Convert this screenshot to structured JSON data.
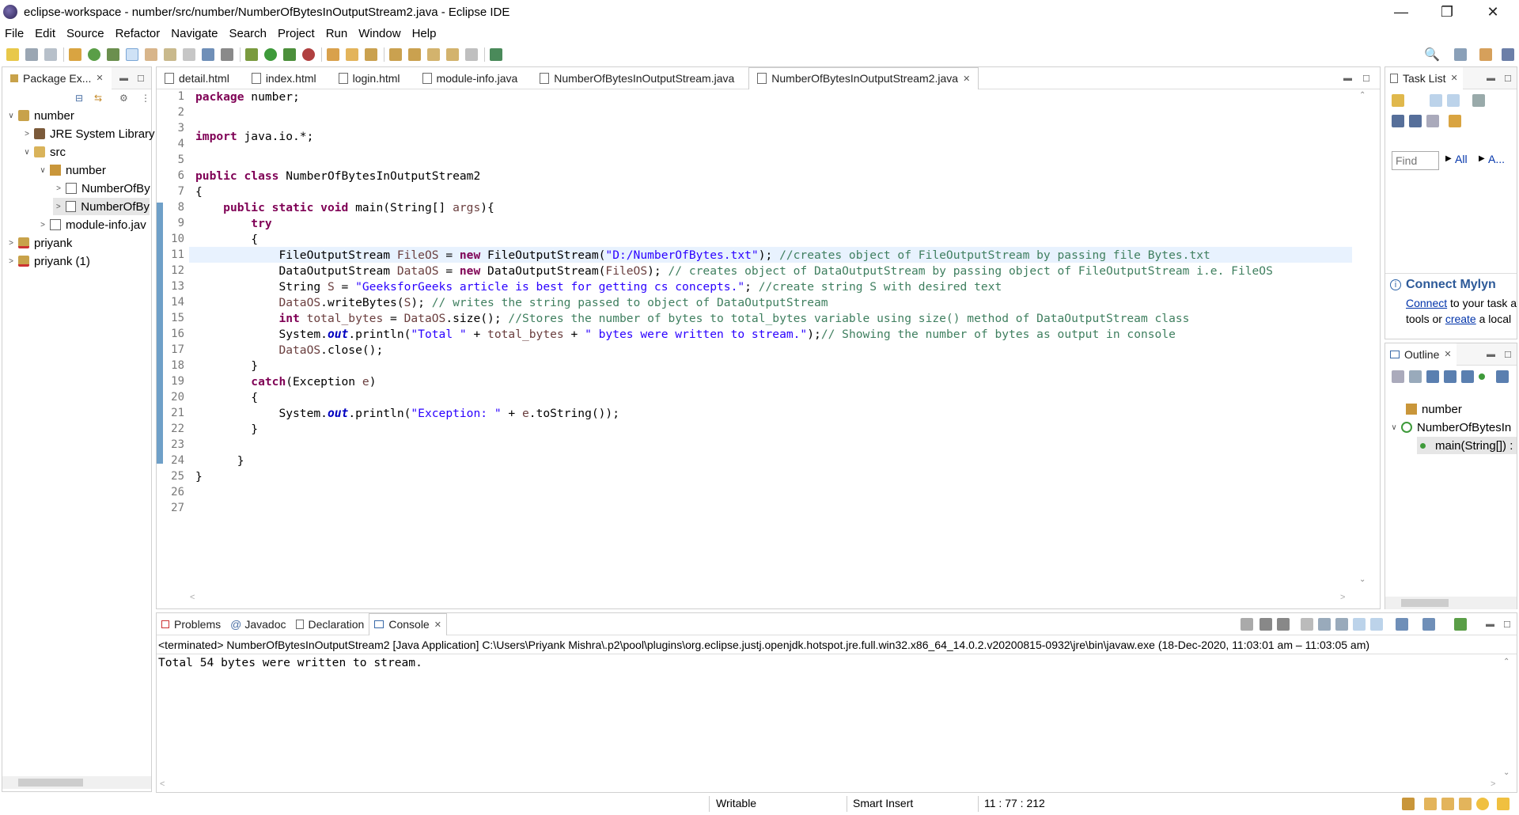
{
  "window": {
    "title": "eclipse-workspace - number/src/number/NumberOfBytesInOutputStream2.java - Eclipse IDE",
    "min": "—",
    "max": "❐",
    "close": "✕"
  },
  "menu": [
    "File",
    "Edit",
    "Source",
    "Refactor",
    "Navigate",
    "Search",
    "Project",
    "Run",
    "Window",
    "Help"
  ],
  "package_explorer": {
    "tab_label": "Package Ex...",
    "tree": [
      {
        "label": "number",
        "arrow": "∨",
        "icon": "project-icon"
      },
      {
        "label": "JRE System Library",
        "arrow": ">",
        "icon": "library-icon"
      },
      {
        "label": "src",
        "arrow": "∨",
        "icon": "source-folder-icon"
      },
      {
        "label": "number",
        "arrow": "∨",
        "icon": "package-icon"
      },
      {
        "label": "NumberOfBy",
        "arrow": ">",
        "icon": "java-file-icon"
      },
      {
        "label": "NumberOfBy",
        "arrow": ">",
        "icon": "java-file-icon"
      },
      {
        "label": "module-info.jav",
        "arrow": ">",
        "icon": "java-file-icon"
      },
      {
        "label": "priyank",
        "arrow": ">",
        "icon": "project-icon"
      },
      {
        "label": "priyank (1)",
        "arrow": ">",
        "icon": "project-icon"
      }
    ]
  },
  "editor": {
    "tabs": [
      "detail.html",
      "index.html",
      "login.html",
      "module-info.java",
      "NumberOfBytesInOutputStream.java",
      "NumberOfBytesInOutputStream2.java"
    ],
    "line_numbers": [
      "1",
      "2",
      "3",
      "4",
      "5",
      "6",
      "7",
      "8",
      "9",
      "10",
      "11",
      "12",
      "13",
      "14",
      "15",
      "16",
      "17",
      "18",
      "19",
      "20",
      "21",
      "22",
      "23",
      "24",
      "25",
      "26",
      "27"
    ],
    "code": {
      "l1_kw": "package",
      "l1_rest": " number;",
      "l4_kw": "import",
      "l4_rest": " java.io.*;",
      "l6_kw": "public class",
      "l6_rest": " NumberOfBytesInOutputStream2",
      "l7": "{",
      "l8_kw": "public static void",
      "l8_rest": " main(String[] ",
      "l8_param": "args",
      "l8_end": "){",
      "l9_kw": "try",
      "l10": "{",
      "l11_a": "FileOutputStream ",
      "l11_var": "FileOS",
      "l11_b": " = ",
      "l11_kw": "new",
      "l11_c": " FileOutputStream(",
      "l11_str": "\"D:/NumberOfBytes.txt\"",
      "l11_d": "); ",
      "l11_cmt": "//creates object of FileOutputStream by passing file Bytes.txt",
      "l12_a": "DataOutputStream ",
      "l12_var": "DataOS",
      "l12_b": " = ",
      "l12_kw": "new",
      "l12_c": " DataOutputStream(",
      "l12_var2": "FileOS",
      "l12_d": "); ",
      "l12_cmt": "// creates object of DataOutputStream by passing object of FileOutputStream i.e. FileOS",
      "l13_a": "String ",
      "l13_var": "S",
      "l13_b": " = ",
      "l13_str": "\"GeeksforGeeks article is best for getting cs concepts.\"",
      "l13_c": "; ",
      "l13_cmt": "//create string S with desired text",
      "l14_var": "DataOS",
      "l14_a": ".writeBytes(",
      "l14_var2": "S",
      "l14_b": "); ",
      "l14_cmt": "// writes the string passed to object of DataOutputStream",
      "l15_kw": "int",
      "l15_a": " ",
      "l15_var": "total_bytes",
      "l15_b": " = ",
      "l15_var2": "DataOS",
      "l15_c": ".size(); ",
      "l15_cmt": "//Stores the number of bytes to total_bytes variable using size() method of DataOutputStream class",
      "l16_a": "System.",
      "l16_fld": "out",
      "l16_b": ".println(",
      "l16_str1": "\"Total \"",
      "l16_c": " + ",
      "l16_var": "total_bytes",
      "l16_d": " + ",
      "l16_str2": "\" bytes were written to stream.\"",
      "l16_e": ");",
      "l16_cmt": "// Showing the number of bytes as output in console",
      "l17_var": "DataOS",
      "l17_a": ".close();",
      "l18": "}",
      "l19_kw": "catch",
      "l19_a": "(Exception ",
      "l19_var": "e",
      "l19_b": ")",
      "l20": "{",
      "l21_a": "System.",
      "l21_fld": "out",
      "l21_b": ".println(",
      "l21_str": "\"Exception: \"",
      "l21_c": " + ",
      "l21_var": "e",
      "l21_d": ".toString());",
      "l22": "}",
      "l24": "}",
      "l25": "}"
    }
  },
  "task_list": {
    "tab_label": "Task List",
    "find_placeholder": "Find",
    "all": "All",
    "a": "A..."
  },
  "mylyn": {
    "title": "Connect Mylyn",
    "connect": "Connect",
    "text1": " to your task a",
    "text2": "tools or ",
    "create": "create",
    "text3": " a local"
  },
  "outline": {
    "tab_label": "Outline",
    "items": [
      "number",
      "NumberOfBytesIn",
      "main(String[]) :"
    ]
  },
  "bottom": {
    "tabs": [
      "Problems",
      "Javadoc",
      "Declaration",
      "Console"
    ],
    "terminated": "<terminated> NumberOfBytesInOutputStream2 [Java Application] C:\\Users\\Priyank Mishra\\.p2\\pool\\plugins\\org.eclipse.justj.openjdk.hotspot.jre.full.win32.x86_64_14.0.2.v20200815-0932\\jre\\bin\\javaw.exe  (18-Dec-2020, 11:03:01 am – 11:03:05 am)",
    "output": "Total 54 bytes were written to stream."
  },
  "status": {
    "writable": "Writable",
    "insert": "Smart Insert",
    "position": "11 : 77 : 212"
  },
  "colors": {
    "keyword": "#7f0055",
    "string": "#2a00ff",
    "comment": "#3f7f5f",
    "field": "#0000c0",
    "variable": "#6a3e3e",
    "current_line": "#e8f2fe",
    "link": "#0033aa"
  }
}
